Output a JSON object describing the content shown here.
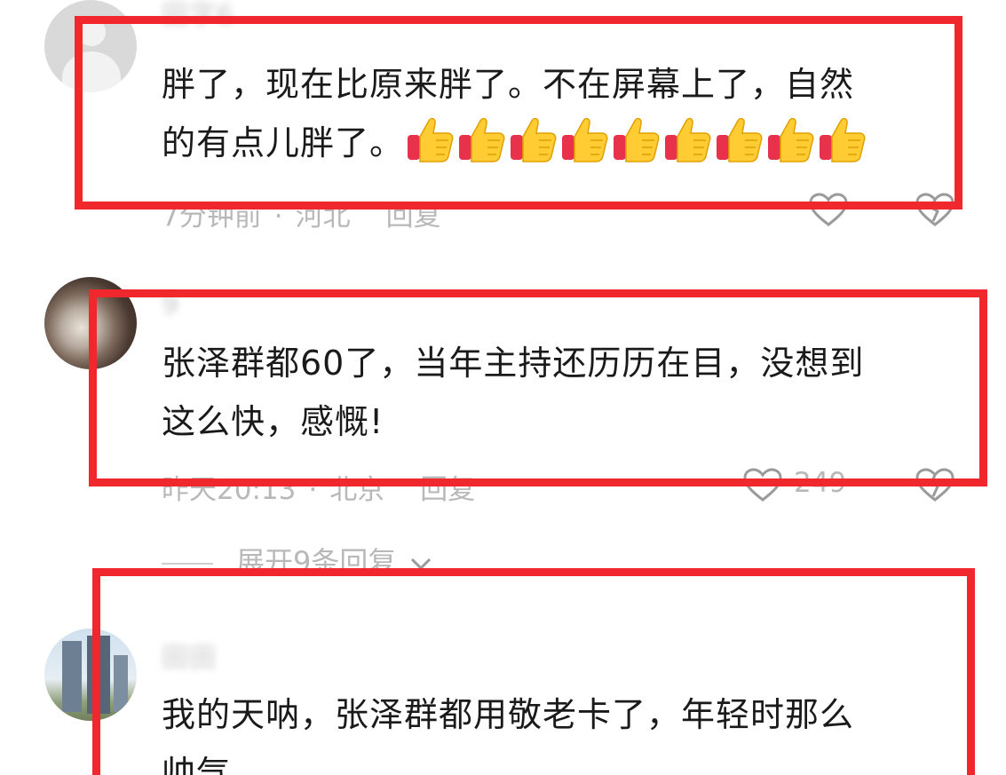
{
  "comments": [
    {
      "username": "田字6",
      "content_line1": "胖了，现在比原来胖了。不在屏幕上了，自然",
      "content_line2": "的有点儿胖了。",
      "emoji": "👍",
      "emoji_count": 9,
      "time": "7分钟前",
      "location": "河北",
      "reply": "回复"
    },
    {
      "username": "9",
      "content_line1": "张泽群都60了，当年主持还历历在目，没想到",
      "content_line2": "这么快，感慨!",
      "time": "昨天20:13",
      "location": "北京",
      "reply": "回复",
      "likes": "249"
    },
    {
      "username": "田田",
      "content_line1": "我的天呐，张泽群都用敬老卡了，年轻时那么",
      "content_line2": "帅气"
    }
  ],
  "expand_replies": "展开9条回复",
  "colors": {
    "highlight": "#f0282d",
    "meta": "#b8b8b8",
    "text": "#1a1a1a"
  }
}
